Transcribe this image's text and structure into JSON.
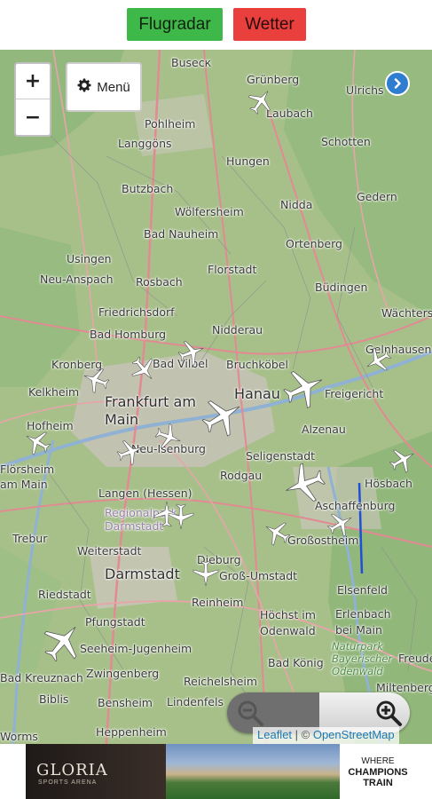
{
  "header": {
    "flugradar_label": "Flugradar",
    "wetter_label": "Wetter",
    "flugradar_color": "#3fb84a",
    "wetter_color": "#e9403e"
  },
  "map_controls": {
    "zoom_in": "+",
    "zoom_out": "−",
    "menu_label": "Menü",
    "menu_icon": "gear-icon",
    "info_icon": "chevron-right-icon"
  },
  "places": [
    {
      "name": "Busecк"
    },
    {
      "name": "Grünberg"
    },
    {
      "name": "Laubach"
    },
    {
      "name": "Ulrichs"
    },
    {
      "name": "Pohlheim"
    },
    {
      "name": "Langgöns"
    },
    {
      "name": "Hungen"
    },
    {
      "name": "Schotten"
    },
    {
      "name": "Butzbach"
    },
    {
      "name": "Gedern"
    },
    {
      "name": "Wölfersheim"
    },
    {
      "name": "Nidda"
    },
    {
      "name": "Bad Nauheim"
    },
    {
      "name": "Ortenberg"
    },
    {
      "name": "Usingen"
    },
    {
      "name": "Florstadt"
    },
    {
      "name": "Neu-Anspach"
    },
    {
      "name": "Rosbach"
    },
    {
      "name": "Büdingen"
    },
    {
      "name": "Friedrichsdorf"
    },
    {
      "name": "Wächters"
    },
    {
      "name": "Nidderau"
    },
    {
      "name": "Bad Homburg"
    },
    {
      "name": "Gelnhausen"
    },
    {
      "name": "Kronberg"
    },
    {
      "name": "Bad Vilbel"
    },
    {
      "name": "Bruchköbel"
    },
    {
      "name": "Kelkheim"
    },
    {
      "name": "Frankfurt am Main"
    },
    {
      "name": "Hanau"
    },
    {
      "name": "Freigericht"
    },
    {
      "name": "Hofheim"
    },
    {
      "name": "Alzenau"
    },
    {
      "name": "Neu-Isenburg"
    },
    {
      "name": "Seligenstadt"
    },
    {
      "name": "Flörsheim am Main"
    },
    {
      "name": "Hösbach"
    },
    {
      "name": "Langen (Hessen)"
    },
    {
      "name": "Rodgau"
    },
    {
      "name": "Aschaffenburg"
    },
    {
      "name": "Regionalpark Darmstadt"
    },
    {
      "name": "Trebur"
    },
    {
      "name": "Weiterstadt"
    },
    {
      "name": "Großostheim"
    },
    {
      "name": "Dieburg"
    },
    {
      "name": "Darmstadt"
    },
    {
      "name": "Groß-Umstadt"
    },
    {
      "name": "Riedstadt"
    },
    {
      "name": "Elsenfeld"
    },
    {
      "name": "Reinheim"
    },
    {
      "name": "Pfungstadt"
    },
    {
      "name": "Höchst im Odenwald"
    },
    {
      "name": "Erlenbach bei Main"
    },
    {
      "name": "Seeheim-Jugenheim"
    },
    {
      "name": "Naturpark Bayerischer Odenwald"
    },
    {
      "name": "Bad König"
    },
    {
      "name": "Freude"
    },
    {
      "name": "Zwingenberg"
    },
    {
      "name": "Reichelsheim"
    },
    {
      "name": "Biblis"
    },
    {
      "name": "Bensheim"
    },
    {
      "name": "Lindenfels"
    },
    {
      "name": "Miltenberg"
    },
    {
      "name": "Heppenheim"
    },
    {
      "name": "Worms"
    },
    {
      "name": "Bad Kreuznach"
    }
  ],
  "attribution": {
    "leaflet": "Leaflet",
    "separator": " | © ",
    "osm": "OpenStreetMap"
  },
  "ad": {
    "brand": "GLORIA",
    "brand_sub": "SPORTS ARENA",
    "slogan_line1": "WHERE",
    "slogan_line2": "CHAMPIONS",
    "slogan_line3": "TRAIN"
  }
}
